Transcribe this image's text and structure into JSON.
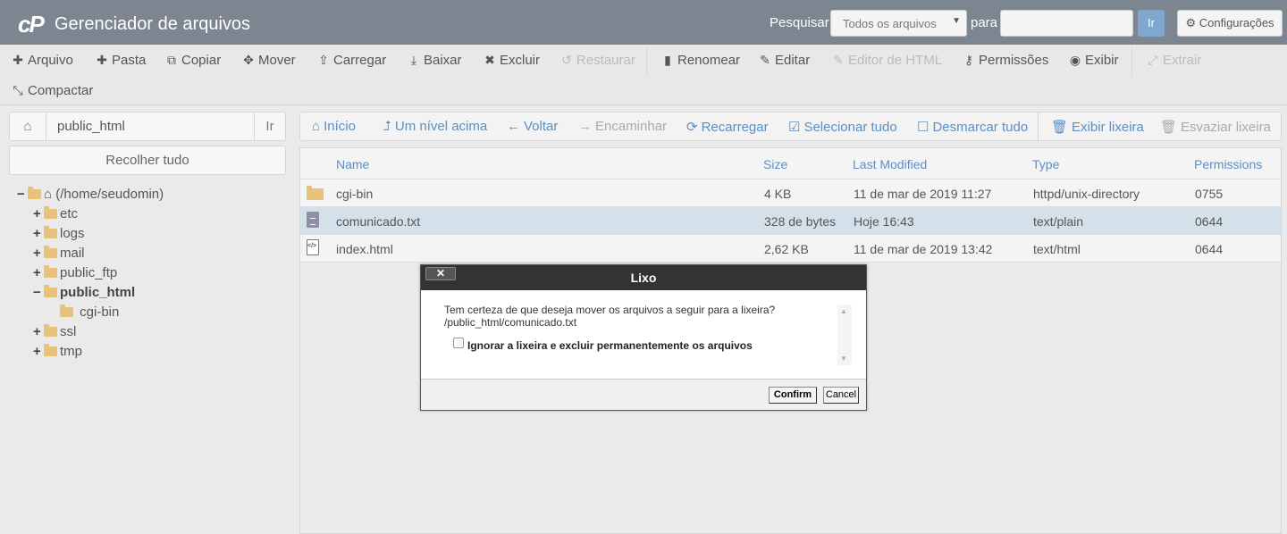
{
  "header": {
    "logo": "cP",
    "title": "Gerenciador de arquivos",
    "search_label": "Pesquisar",
    "search_scope": "Todos os arquivos",
    "para_label": "para",
    "search_value": "",
    "go_label": "Ir",
    "settings_label": "Configurações"
  },
  "toolbar": {
    "items": [
      {
        "label": "Arquivo",
        "icon": "plus-icon",
        "enabled": true
      },
      {
        "label": "Pasta",
        "icon": "plus-icon",
        "enabled": true
      },
      {
        "label": "Copiar",
        "icon": "copy-icon",
        "enabled": true
      },
      {
        "label": "Mover",
        "icon": "move-icon",
        "enabled": true
      },
      {
        "label": "Carregar",
        "icon": "upload-icon",
        "enabled": true
      },
      {
        "label": "Baixar",
        "icon": "download-icon",
        "enabled": true
      },
      {
        "label": "Excluir",
        "icon": "times-icon",
        "enabled": true
      },
      {
        "label": "Restaurar",
        "icon": "undo-icon",
        "enabled": false
      },
      {
        "label": "Renomear",
        "icon": "file-icon",
        "enabled": true
      },
      {
        "label": "Editar",
        "icon": "pencil-icon",
        "enabled": true
      },
      {
        "label": "Editor de HTML",
        "icon": "edit-icon",
        "enabled": false
      },
      {
        "label": "Permissões",
        "icon": "key-icon",
        "enabled": true
      },
      {
        "label": "Exibir",
        "icon": "eye-icon",
        "enabled": true
      },
      {
        "label": "Extrair",
        "icon": "expand-icon",
        "enabled": false
      },
      {
        "label": "Compactar",
        "icon": "compress-icon",
        "enabled": true
      }
    ]
  },
  "sidebar": {
    "path_value": "public_html",
    "path_go": "Ir",
    "collapse_label": "Recolher tudo",
    "tree": [
      {
        "label": "(/home/seudomin)",
        "toggle": "−",
        "type": "home"
      },
      {
        "label": "etc",
        "toggle": "+",
        "type": "folder"
      },
      {
        "label": "logs",
        "toggle": "+",
        "type": "folder"
      },
      {
        "label": "mail",
        "toggle": "+",
        "type": "folder"
      },
      {
        "label": "public_ftp",
        "toggle": "+",
        "type": "folder"
      },
      {
        "label": "public_html",
        "toggle": "−",
        "type": "folder"
      },
      {
        "label": "cgi-bin",
        "toggle": "",
        "type": "folder"
      },
      {
        "label": "ssl",
        "toggle": "+",
        "type": "folder"
      },
      {
        "label": "tmp",
        "toggle": "+",
        "type": "folder"
      }
    ]
  },
  "nav": {
    "items": [
      {
        "label": "Início",
        "icon": "home-icon",
        "enabled": true
      },
      {
        "label": "Um nível acima",
        "icon": "level-up-icon",
        "enabled": true
      },
      {
        "label": "Voltar",
        "icon": "arrow-left-icon",
        "enabled": true
      },
      {
        "label": "Encaminhar",
        "icon": "arrow-right-icon",
        "enabled": false
      },
      {
        "label": "Recarregar",
        "icon": "refresh-icon",
        "enabled": true
      },
      {
        "label": "Selecionar tudo",
        "icon": "check-square-icon",
        "enabled": true
      },
      {
        "label": "Desmarcar tudo",
        "icon": "square-icon",
        "enabled": true
      },
      {
        "label": "Exibir lixeira",
        "icon": "trash-icon",
        "enabled": true
      },
      {
        "label": "Esvaziar lixeira",
        "icon": "trash-icon",
        "enabled": false
      }
    ]
  },
  "files": {
    "headers": {
      "name": "Name",
      "size": "Size",
      "modified": "Last Modified",
      "type": "Type",
      "perms": "Permissions"
    },
    "rows": [
      {
        "name": "cgi-bin",
        "size": "4 KB",
        "modified": "11 de mar de 2019 11:27",
        "type": "httpd/unix-directory",
        "perms": "0755",
        "icon": "folder-icon"
      },
      {
        "name": "comunicado.txt",
        "size": "328 de bytes",
        "modified": "Hoje 16:43",
        "type": "text/plain",
        "perms": "0644",
        "icon": "text-file-icon"
      },
      {
        "name": "index.html",
        "size": "2,62 KB",
        "modified": "11 de mar de 2019 13:42",
        "type": "text/html",
        "perms": "0644",
        "icon": "html-file-icon"
      }
    ]
  },
  "modal": {
    "title": "Lixo",
    "close": "✕",
    "message": "Tem certeza de que deseja mover os arquivos a seguir para a lixeira?",
    "path": "/public_html/comunicado.txt",
    "checkbox_label": "Ignorar a lixeira e excluir permanentemente os arquivos",
    "confirm_label": "Confirm",
    "cancel_label": "Cancel"
  }
}
